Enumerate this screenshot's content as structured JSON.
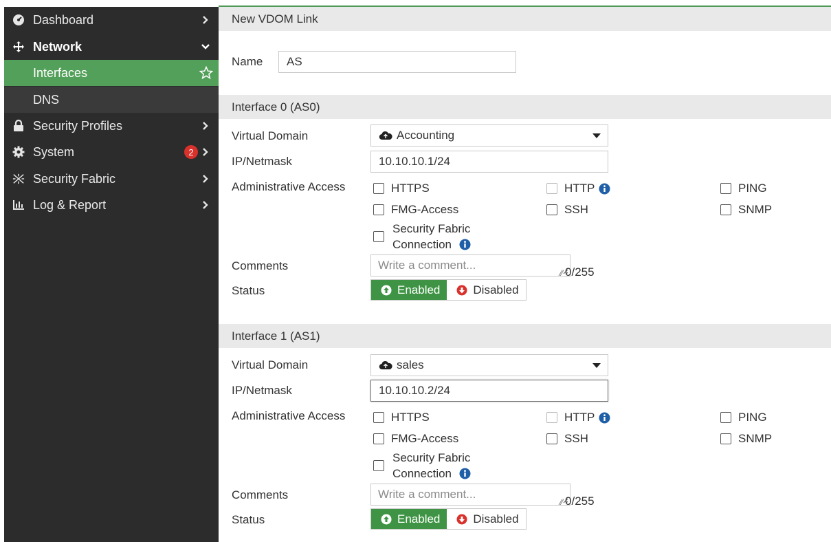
{
  "sidebar": {
    "items": [
      {
        "label": "Dashboard",
        "icon": "dashboard-icon"
      },
      {
        "label": "Network",
        "icon": "network-arrows-icon"
      },
      {
        "label": "Interfaces"
      },
      {
        "label": "DNS"
      },
      {
        "label": "Security Profiles",
        "icon": "lock-icon"
      },
      {
        "label": "System",
        "icon": "gear-icon",
        "badge": "2"
      },
      {
        "label": "Security Fabric",
        "icon": "fabric-icon"
      },
      {
        "label": "Log & Report",
        "icon": "chart-icon"
      }
    ]
  },
  "page": {
    "title": "New VDOM Link",
    "name_label": "Name",
    "name_value": "AS"
  },
  "labels": {
    "virtual_domain": "Virtual Domain",
    "ip_netmask": "IP/Netmask",
    "admin_access": "Administrative Access",
    "comments": "Comments",
    "status": "Status",
    "https": "HTTPS",
    "http": "HTTP",
    "ping": "PING",
    "fmg": "FMG-Access",
    "ssh": "SSH",
    "snmp": "SNMP",
    "fabric_line1": "Security Fabric",
    "fabric_line2": "Connection",
    "enabled": "Enabled",
    "disabled": "Disabled",
    "counter": "0/255",
    "comment_placeholder": "Write a comment..."
  },
  "interfaces": [
    {
      "heading": "Interface 0 (AS0)",
      "vdom": "Accounting",
      "ip": "10.10.10.1/24"
    },
    {
      "heading": "Interface 1 (AS1)",
      "vdom": "sales",
      "ip": "10.10.10.2/24"
    }
  ],
  "colors": {
    "accent": "#53a05a",
    "enabled": "#3e9444",
    "info": "#1f5fa8",
    "badge": "#d9312b"
  }
}
